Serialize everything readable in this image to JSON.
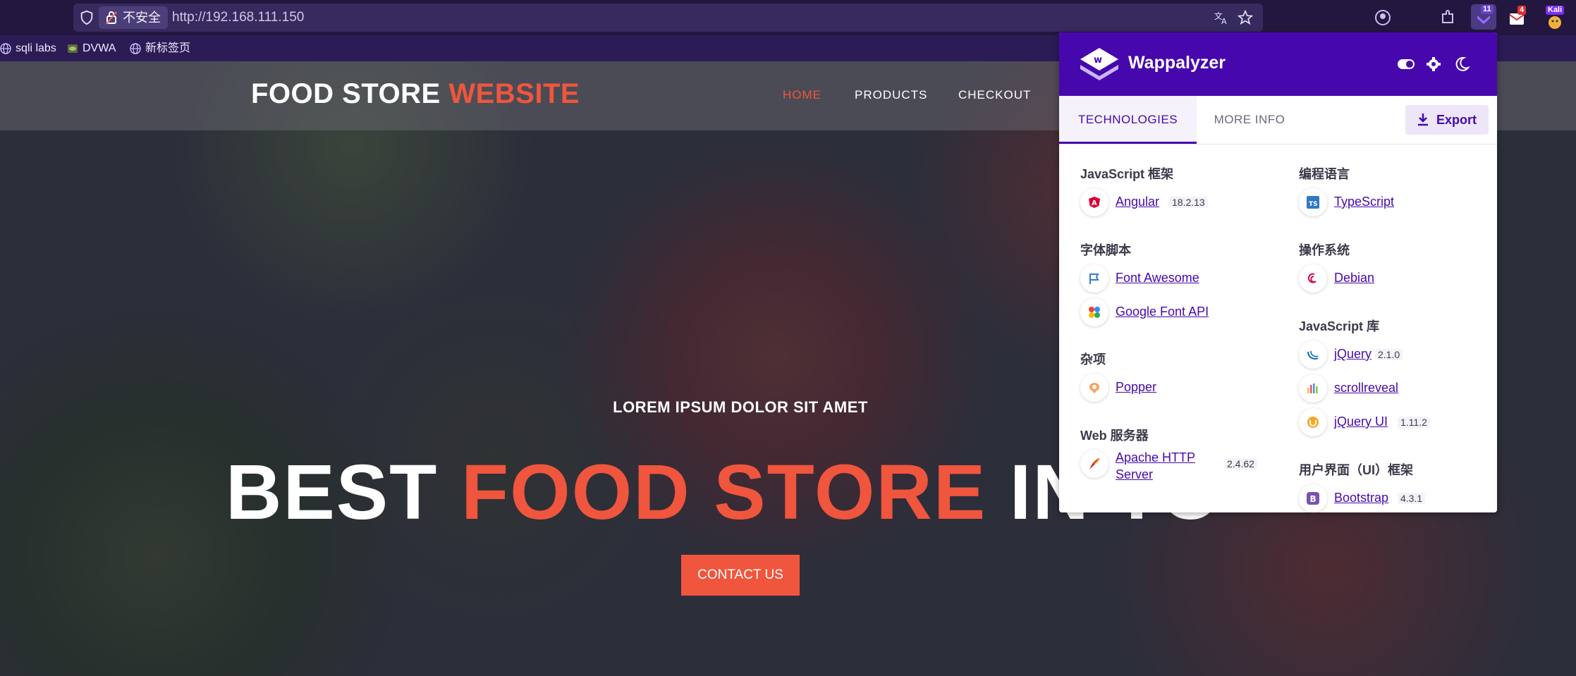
{
  "browser": {
    "insecure_label": "不安全",
    "url": "http://192.168.111.150",
    "badges": {
      "wappalyzer_count": "11",
      "mail_count": "4",
      "profile": "Kali"
    },
    "bookmarks": [
      {
        "label": "sqli labs",
        "icon": "globe-icon"
      },
      {
        "label": "DVWA",
        "icon": "dvwa-icon"
      },
      {
        "label": "新标签页",
        "icon": "globe-icon"
      }
    ]
  },
  "site": {
    "logo_main": "FOOD STORE",
    "logo_accent": "WEBSITE",
    "nav": [
      "HOME",
      "PRODUCTS",
      "CHECKOUT"
    ],
    "hero_kicker": "LOREM IPSUM DOLOR SIT AMET",
    "hero_white": "BEST",
    "hero_accent": "FOOD STORE",
    "hero_white2": "IN TO",
    "contact_button": "CONTACT US"
  },
  "wappalyzer": {
    "title": "Wappalyzer",
    "tabs": [
      "TECHNOLOGIES",
      "MORE INFO"
    ],
    "export_label": "Export",
    "left": [
      {
        "category": "JavaScript 框架",
        "items": [
          {
            "name": "Angular",
            "version": "18.2.13",
            "icon": "angular-icon"
          }
        ]
      },
      {
        "category": "字体脚本",
        "items": [
          {
            "name": "Font Awesome",
            "version": "",
            "icon": "font-awesome-icon"
          },
          {
            "name": "Google Font API",
            "version": "",
            "icon": "google-font-icon"
          }
        ]
      },
      {
        "category": "杂项",
        "items": [
          {
            "name": "Popper",
            "version": "",
            "icon": "popper-icon"
          }
        ]
      },
      {
        "category": "Web 服务器",
        "items": [
          {
            "name": "Apache HTTP Server",
            "version": "2.4.62",
            "icon": "apache-icon"
          }
        ]
      }
    ],
    "right": [
      {
        "category": "编程语言",
        "items": [
          {
            "name": "TypeScript",
            "version": "",
            "icon": "typescript-icon"
          }
        ]
      },
      {
        "category": "操作系统",
        "items": [
          {
            "name": "Debian",
            "version": "",
            "icon": "debian-icon"
          }
        ]
      },
      {
        "category": "JavaScript 库",
        "items": [
          {
            "name": "jQuery",
            "version": "2.1.0",
            "icon": "jquery-icon"
          },
          {
            "name": "scrollreveal",
            "version": "",
            "icon": "scrollreveal-icon"
          },
          {
            "name": "jQuery UI",
            "version": "1.11.2",
            "icon": "jquery-ui-icon"
          }
        ]
      },
      {
        "category": "用户界面（UI）框架",
        "items": [
          {
            "name": "Bootstrap",
            "version": "4.3.1",
            "icon": "bootstrap-icon"
          }
        ]
      }
    ]
  }
}
